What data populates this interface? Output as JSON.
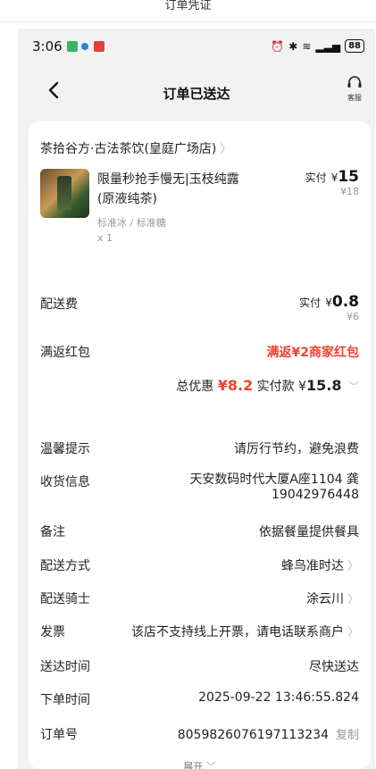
{
  "caption": "订单凭证",
  "status_bar": {
    "time": "3:06",
    "battery": "88"
  },
  "nav": {
    "back": "‹",
    "title": "订单已送达",
    "service_label": "客服"
  },
  "shop": {
    "name": "茶拾谷方·古法茶饮(皇庭广场店)"
  },
  "product": {
    "name_line1": "限量秒抢手慢无|玉枝纯露",
    "name_line2": "(原液纯茶)",
    "spec": "标准冰 / 标准糖",
    "qty": "x 1",
    "paid_label": "实付",
    "paid_currency": "¥",
    "paid_amount": "15",
    "original_price": "¥18"
  },
  "delivery_fee": {
    "label": "配送费",
    "paid_label": "实付",
    "currency": "¥",
    "amount": "0.8",
    "original": "¥6"
  },
  "red_packet": {
    "label": "满返红包",
    "value": "满返¥2商家红包"
  },
  "summary": {
    "discount_label": "总优惠",
    "discount_value": "¥8.2",
    "pay_label": "实付款",
    "pay_currency": "¥",
    "pay_value": "15.8"
  },
  "rows": {
    "tip": {
      "label": "温馨提示",
      "value": "请厉行节约，避免浪费"
    },
    "address": {
      "label": "收货信息",
      "value_line1": "天安数码时代大厦A座1104 龚",
      "value_line2": "19042976448"
    },
    "note": {
      "label": "备注",
      "value": "依据餐量提供餐具"
    },
    "delivery_method": {
      "label": "配送方式",
      "value": "蜂鸟准时达"
    },
    "rider": {
      "label": "配送骑士",
      "value": "涂云川"
    },
    "invoice": {
      "label": "发票",
      "value": "该店不支持线上开票，请电话联系商户"
    },
    "arrive_time": {
      "label": "送达时间",
      "value": "尽快送达"
    },
    "order_time": {
      "label": "下单时间",
      "value": "2025-09-22 13:46:55.824"
    },
    "order_no": {
      "label": "订单号",
      "value": "8059826076197113234",
      "copy": "复制"
    }
  },
  "expand_label": "展开",
  "colors": {
    "accent_red": "#f0422f",
    "page_bg": "#f2f2f2"
  }
}
